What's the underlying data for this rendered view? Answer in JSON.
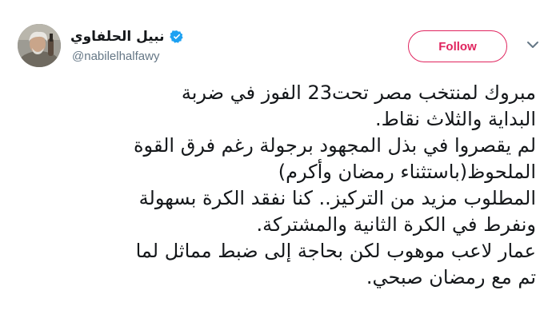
{
  "user": {
    "display_name": "نبيل الحلفاوي",
    "handle": "@nabilelhalfawy",
    "verified": true
  },
  "follow_button": {
    "label": "Follow",
    "accent_color": "#e0245e"
  },
  "icons": {
    "verified": "verified-badge-icon",
    "menu": "chevron-down-icon"
  },
  "tweet": {
    "lines": [
      "مبروك لمنتخب مصر تحت23 الفوز في ضربة",
      "البداية والثلاث نقاط.",
      "لم يقصروا في بذل المجهود برجولة رغم فرق القوة",
      "الملحوظ(باستثناء رمضان وأكرم)",
      "المطلوب مزيد من التركيز.. كنا نفقد الكرة بسهولة",
      "ونفرط في الكرة الثانية والمشتركة.",
      "عمار لاعب موهوب لكن بحاجة إلى ضبط مماثل لما",
      "تم مع رمضان صبحي."
    ]
  }
}
